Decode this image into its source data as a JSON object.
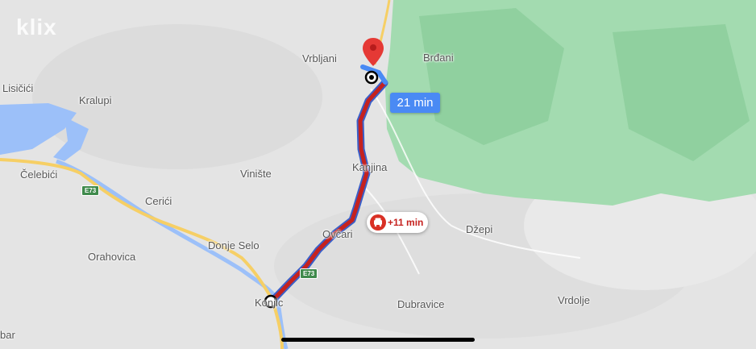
{
  "map": {
    "watermark": "klix",
    "places": [
      {
        "id": "vrbljani",
        "label": "Vrbljani"
      },
      {
        "id": "brdani",
        "label": "Brđani"
      },
      {
        "id": "lisicici",
        "label": "Lisičići"
      },
      {
        "id": "kralupi",
        "label": "Kralupi"
      },
      {
        "id": "celebici",
        "label": "Čelebići"
      },
      {
        "id": "cerici",
        "label": "Cerići"
      },
      {
        "id": "viniste",
        "label": "Vinište"
      },
      {
        "id": "kanjina",
        "label": "Kanjina"
      },
      {
        "id": "dzepi",
        "label": "Džepi"
      },
      {
        "id": "donje-selo",
        "label": "Donje Selo"
      },
      {
        "id": "ovcari",
        "label": "Ovčari"
      },
      {
        "id": "orahovica",
        "label": "Orahovica"
      },
      {
        "id": "konjic",
        "label": "Konjic"
      },
      {
        "id": "dubravice",
        "label": "Dubravice"
      },
      {
        "id": "vrdolje",
        "label": "Vrdolje"
      },
      {
        "id": "bar-partial",
        "label": "bar"
      }
    ],
    "road_shields": [
      "E73",
      "E73"
    ],
    "route": {
      "eta_label": "21 min",
      "traffic_delay_label": "+11 min",
      "traffic_icon": "car-icon"
    },
    "colors": {
      "route_traffic": "#c5221f",
      "route_outline": "#3a5fc8",
      "eta_bubble": "#4a8af4",
      "destination_pin": "#e53935",
      "forest": "#8fd19e",
      "water": "#9cc0f9",
      "highway": "#f6cf65"
    }
  }
}
